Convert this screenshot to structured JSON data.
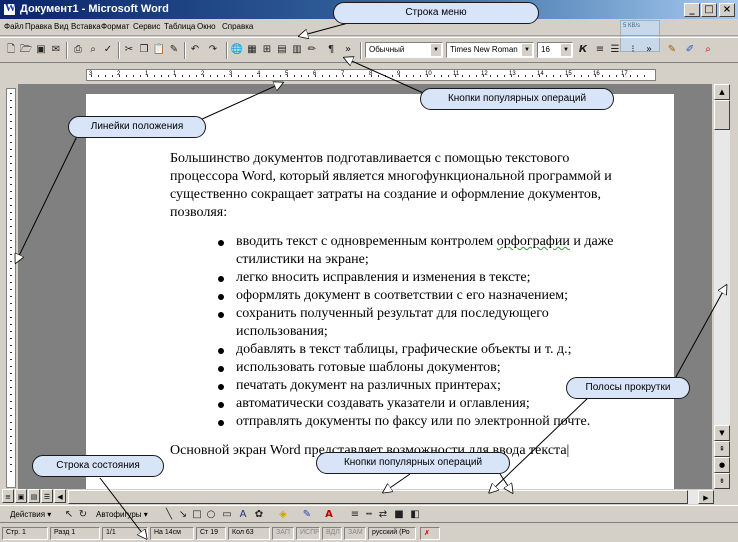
{
  "window": {
    "title": "Документ1 - Microsoft Word",
    "buttons": {
      "minimize": "_",
      "maximize": "□",
      "close": "×"
    }
  },
  "menu": {
    "items": [
      "Файл",
      "Правка",
      "Вид",
      "Вставка",
      "Формат",
      "Сервис",
      "Таблица",
      "Окно",
      "Справка"
    ]
  },
  "toolbar": {
    "style": "Обычный",
    "font": "Times New Roman",
    "size": "16",
    "bold": "Ж",
    "italic": "К",
    "pilcrow": "¶"
  },
  "ruler": {
    "numbers": [
      "3",
      "2",
      "1",
      "1",
      "2",
      "3",
      "4",
      "5",
      "6",
      "7",
      "8",
      "9",
      "10",
      "11",
      "12",
      "13",
      "14",
      "15",
      "16",
      "17"
    ]
  },
  "document": {
    "intro": "Большинство документов подготавливается с помощью текстового процессора Word, который является многофункциональной программой и существенно сокращает затраты на создание и оформление документов, позволяя:",
    "bullets": [
      {
        "before": "вводить текст с одновременным контролем ",
        "marked": "орфографии",
        "after": " и даже стилистики на экране;"
      },
      {
        "before": "легко вносить исправления и изменения в тексте;",
        "marked": "",
        "after": ""
      },
      {
        "before": "оформлять документ в соответствии с его назначением;",
        "marked": "",
        "after": ""
      },
      {
        "before": "сохранить полученный результат для последующего использования;",
        "marked": "",
        "after": ""
      },
      {
        "before": "добавлять в текст таблицы, графические объекты и т. д.;",
        "marked": "",
        "after": ""
      },
      {
        "before": "использовать готовые шаблоны документов;",
        "marked": "",
        "after": ""
      },
      {
        "before": "печатать документ на различных принтерах;",
        "marked": "",
        "after": ""
      },
      {
        "before": "автоматически создавать указатели и оглавления;",
        "marked": "",
        "after": ""
      },
      {
        "before": "отправлять документы по факсу или по электронной почте.",
        "marked": "",
        "after": ""
      }
    ],
    "last_line": "Основной экран Word представляет возможности для ввода текста"
  },
  "drawbar": {
    "actions": "Действия",
    "autoshapes": "Автофигуры"
  },
  "statusbar": {
    "page": "Стр. 1",
    "section": "Разд 1",
    "pages": "1/1",
    "at": "На 14см",
    "line": "Ст 19",
    "col": "Кол 63",
    "rec": "ЗАП",
    "trk": "ИСПР",
    "ext": "ВДЛ",
    "ovr": "ЗАМ",
    "lang": "русский (Ро"
  },
  "widget": {
    "text": "5 КВ/s"
  },
  "callouts": {
    "menu_bar": "Строка меню",
    "toolbar_top": "Кнопки популярных операций",
    "rulers": "Линейки положения",
    "scrollbars": "Полосы прокрутки",
    "status_bar": "Строка состояния",
    "toolbar_bottom": "Кнопки популярных операций"
  },
  "colors": {
    "title_gradient_start": "#0a246a",
    "title_gradient_end": "#a6caf0",
    "callout_fill": "#d8e4f8",
    "chrome": "#d4d0c8",
    "workspace": "#808080"
  }
}
